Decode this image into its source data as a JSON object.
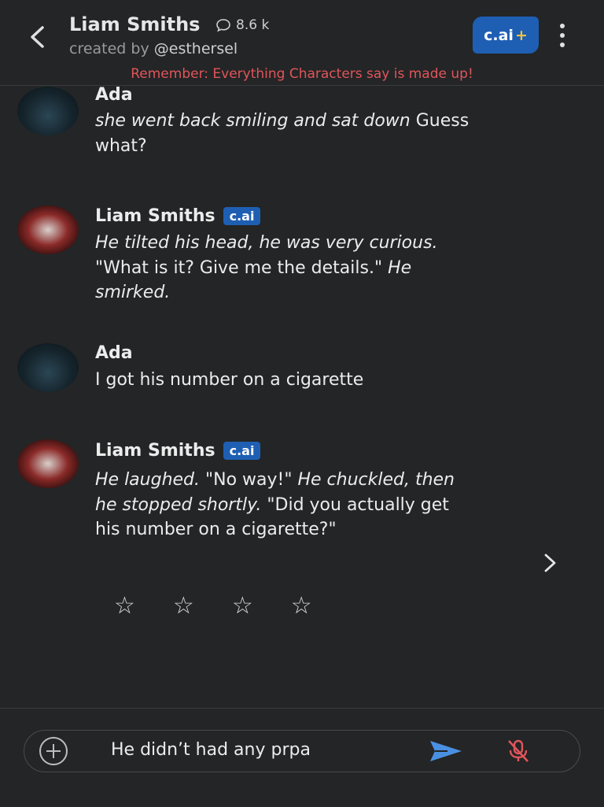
{
  "header": {
    "title": "Liam Smiths",
    "message_count": "8.6 k",
    "creator_prefix": "created by",
    "creator_handle": "@esthersel",
    "premium_badge": "c.ai",
    "premium_plus": "+",
    "notice": "Remember: Everything Characters say is made up!"
  },
  "messages": [
    {
      "sender": "Ada",
      "is_bot": false,
      "parts": [
        {
          "text": "she went back smiling and sat down",
          "italic": true
        },
        {
          "text": " Guess what?",
          "italic": false
        }
      ]
    },
    {
      "sender": "Liam Smiths",
      "is_bot": true,
      "badge": "c.ai",
      "parts": [
        {
          "text": "He tilted his head, he was very curious.",
          "italic": true
        },
        {
          "text": " \"What is it? Give me the details.\" ",
          "italic": false
        },
        {
          "text": "He smirked.",
          "italic": true
        }
      ]
    },
    {
      "sender": "Ada",
      "is_bot": false,
      "parts": [
        {
          "text": "I got his number on a cigarette",
          "italic": false
        }
      ]
    },
    {
      "sender": "Liam Smiths",
      "is_bot": true,
      "badge": "c.ai",
      "parts": [
        {
          "text": "He laughed.",
          "italic": true
        },
        {
          "text": " \"No way!\" ",
          "italic": false
        },
        {
          "text": "He chuckled, then he stopped shortly.",
          "italic": true
        },
        {
          "text": " \"Did you actually get his number on a cigarette?\"",
          "italic": false
        }
      ]
    }
  ],
  "rating": {
    "stars": [
      "☆",
      "☆",
      "☆",
      "☆"
    ]
  },
  "composer": {
    "value": "He didn’t had any prpa"
  },
  "colors": {
    "background": "#242526",
    "accent_blue": "#1f5fb3",
    "notice_red": "#e0555b",
    "send_blue": "#4a90e2",
    "mic_red": "#e0555b"
  },
  "icons": {
    "back": "chevron-left-icon",
    "count": "chat-bubble-icon",
    "menu": "kebab-menu-icon",
    "next": "chevron-right-icon",
    "add": "plus-circle-icon",
    "send": "send-icon",
    "mic": "mic-off-icon"
  }
}
